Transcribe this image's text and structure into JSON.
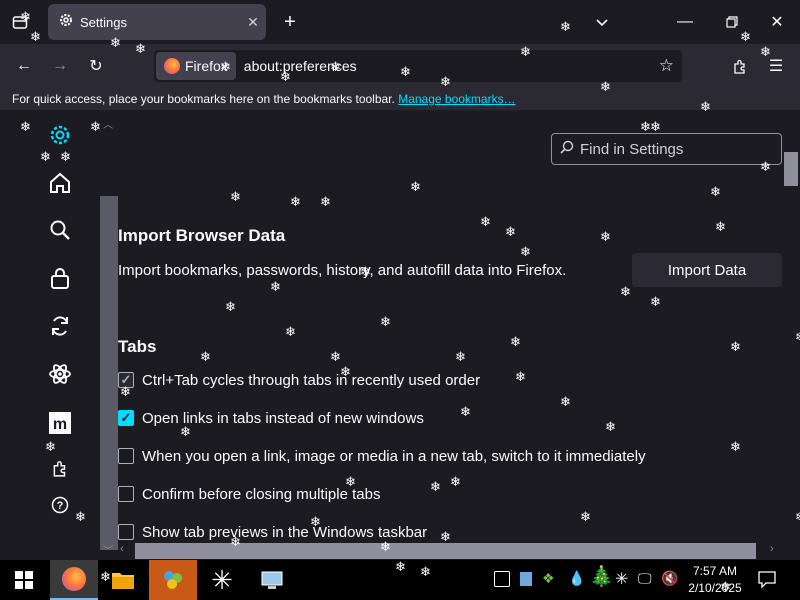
{
  "tab": {
    "title": "Settings"
  },
  "nav": {
    "identity_label": "Firefox",
    "url": "about:preferences"
  },
  "bookmarks_bar": {
    "text": "For quick access, place your bookmarks here on the bookmarks toolbar.",
    "link": "Manage bookmarks…"
  },
  "search": {
    "placeholder": "Find in Settings"
  },
  "sections": {
    "import": {
      "title": "Import Browser Data",
      "description": "Import bookmarks, passwords, history, and autofill data into Firefox.",
      "button": "Import Data"
    },
    "tabs": {
      "title": "Tabs",
      "options": [
        {
          "label": "Ctrl+Tab cycles through tabs in recently used order",
          "checked": true
        },
        {
          "label": "Open links in tabs instead of new windows",
          "checked": true
        },
        {
          "label": "When you open a link, image or media in a new tab, switch to it immediately",
          "checked": false
        },
        {
          "label": "Confirm before closing multiple tabs",
          "checked": false
        },
        {
          "label": "Show tab previews in the Windows taskbar",
          "checked": false
        }
      ]
    }
  },
  "sidebar_icons": [
    "gear-icon",
    "home-icon",
    "search-icon",
    "lock-icon",
    "sync-icon",
    "atom-icon",
    "mozilla-icon",
    "extensions-icon",
    "help-icon"
  ],
  "taskbar": {
    "time": "7:57 AM",
    "date": "2/10/2025"
  },
  "colors": {
    "accent": "#00ddff",
    "background": "#1c1b22",
    "toolbar": "#2b2a33",
    "tab_active": "#42414d"
  }
}
